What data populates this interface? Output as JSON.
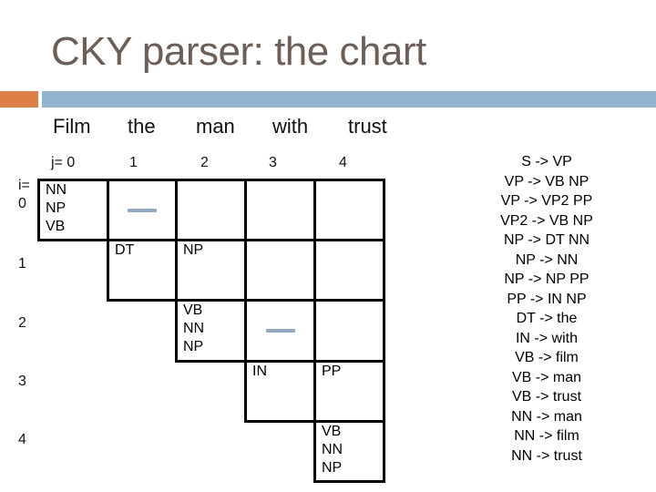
{
  "title": "CKY parser: the chart",
  "words": [
    "Film",
    "the",
    "man",
    "with",
    "trust"
  ],
  "col_header": {
    "prefix": "j= ",
    "indices": [
      "0",
      "1",
      "2",
      "3",
      "4"
    ]
  },
  "row_header": {
    "prefix": "i=",
    "indices": [
      "0",
      "1",
      "2",
      "3",
      "4"
    ]
  },
  "cells": [
    {
      "i": 0,
      "j": 0,
      "labels": "NN\nNP\nVB"
    },
    {
      "i": 0,
      "j": 1,
      "labels": "",
      "dash": true
    },
    {
      "i": 0,
      "j": 2,
      "labels": ""
    },
    {
      "i": 0,
      "j": 3,
      "labels": ""
    },
    {
      "i": 0,
      "j": 4,
      "labels": ""
    },
    {
      "i": 1,
      "j": 1,
      "labels": "DT"
    },
    {
      "i": 1,
      "j": 2,
      "labels": "NP"
    },
    {
      "i": 1,
      "j": 3,
      "labels": ""
    },
    {
      "i": 1,
      "j": 4,
      "labels": ""
    },
    {
      "i": 2,
      "j": 2,
      "labels": "VB\nNN\nNP"
    },
    {
      "i": 2,
      "j": 3,
      "labels": "",
      "dash": true
    },
    {
      "i": 2,
      "j": 4,
      "labels": ""
    },
    {
      "i": 3,
      "j": 3,
      "labels": "IN"
    },
    {
      "i": 3,
      "j": 4,
      "labels": "PP"
    },
    {
      "i": 4,
      "j": 4,
      "labels": "VB\nNN\nNP"
    }
  ],
  "grammar_rules": [
    "S -> VP",
    "VP -> VB NP",
    "VP -> VP2 PP",
    "VP2 -> VB NP",
    "NP -> DT NN",
    "NP -> NN",
    "NP -> NP PP",
    "PP -> IN NP",
    "DT -> the",
    "IN -> with",
    "VB -> film",
    "VB -> man",
    "VB -> trust",
    "NN -> man",
    "NN -> film",
    "NN -> trust"
  ],
  "colors": {
    "title": "#6b5f58",
    "accent_orange": "#dd8048",
    "accent_blue": "#93b3cf",
    "dash": "#93a9c2"
  }
}
